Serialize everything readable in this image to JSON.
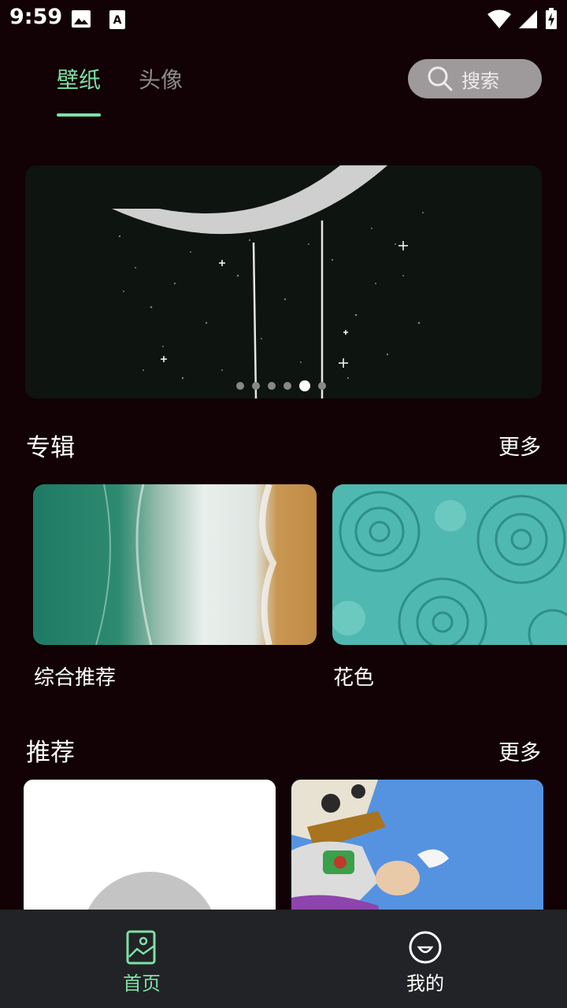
{
  "status_bar": {
    "time": "9:59"
  },
  "tabs": [
    {
      "label": "壁纸",
      "active": true
    },
    {
      "label": "头像",
      "active": false
    }
  ],
  "search": {
    "label": "搜索"
  },
  "banner": {
    "page_count": 6,
    "active_index": 4
  },
  "album_section": {
    "title": "专辑",
    "more": "更多",
    "items": [
      {
        "label": "综合推荐"
      },
      {
        "label": "花色"
      }
    ]
  },
  "recommend_section": {
    "title": "推荐",
    "more": "更多"
  },
  "bottom_nav": {
    "items": [
      {
        "label": "首页",
        "active": true
      },
      {
        "label": "我的",
        "active": false
      }
    ]
  },
  "colors": {
    "background": "#120105",
    "accent": "#7fe0a5",
    "nav_background": "#222326"
  }
}
